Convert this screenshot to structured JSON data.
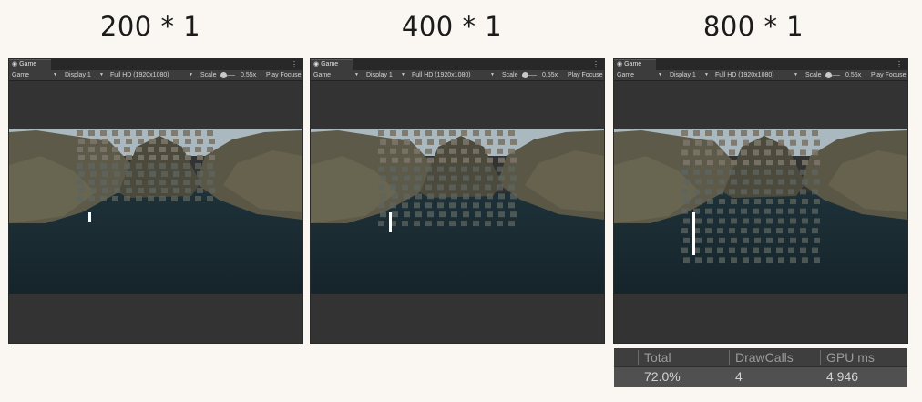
{
  "headings": [
    "200 * 1",
    "400 * 1",
    "800 * 1"
  ],
  "panels": [
    {
      "tab_label": "Game",
      "menu_icon": "kebab-menu-icon",
      "toolbar": {
        "view_mode": "Game",
        "display": "Display 1",
        "resolution": "Full HD (1920x1080)",
        "scale_label": "Scale",
        "scale_value": "0.55x",
        "play_mode": "Play Focuse"
      },
      "bar_height_fraction": 0.06
    },
    {
      "tab_label": "Game",
      "menu_icon": "kebab-menu-icon",
      "toolbar": {
        "view_mode": "Game",
        "display": "Display 1",
        "resolution": "Full HD (1920x1080)",
        "scale_label": "Scale",
        "scale_value": "0.55x",
        "play_mode": "Play Focuse"
      },
      "bar_height_fraction": 0.12
    },
    {
      "tab_label": "Game",
      "menu_icon": "kebab-menu-icon",
      "toolbar": {
        "view_mode": "Game",
        "display": "Display 1",
        "resolution": "Full HD (1920x1080)",
        "scale_label": "Scale",
        "scale_value": "0.55x",
        "play_mode": "Play Focuse"
      },
      "bar_height_fraction": 0.26
    }
  ],
  "stats": {
    "headers": [
      "Total",
      "DrawCalls",
      "GPU ms"
    ],
    "values": [
      "72.0%",
      "4",
      "4.946"
    ]
  },
  "colors": {
    "page_background": "#faf7f2",
    "editor_panel": "#383838",
    "sky": "#a9b9bf",
    "water": "#16242b",
    "bar": "#ffffff"
  }
}
